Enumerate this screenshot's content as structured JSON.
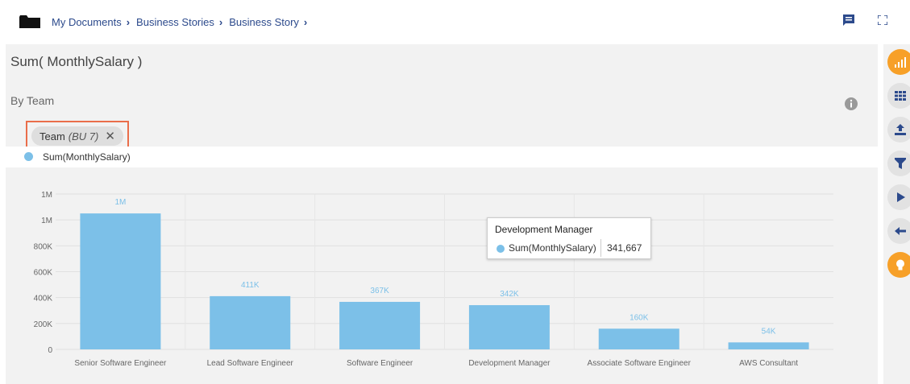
{
  "breadcrumb": {
    "items": [
      "My Documents",
      "Business Stories",
      "Business Story"
    ]
  },
  "widget": {
    "title": "Sum( MonthlySalary )",
    "subtitle": "By Team"
  },
  "filter_chip": {
    "label": "Team",
    "value": "(BU 7)",
    "close": "✕"
  },
  "legend": {
    "label": "Sum(MonthlySalary)",
    "color": "#7cc0e8"
  },
  "tooltip": {
    "title": "Development Manager",
    "series": "Sum(MonthlySalary)",
    "value": "341,667"
  },
  "colors": {
    "bar": "#7cc0e8",
    "accent": "#f7a028",
    "highlight_border": "#ea6d4a",
    "breadcrumb_text": "#2c4a8c"
  },
  "icons": {
    "top_right": [
      "comment-icon",
      "fullscreen-icon"
    ],
    "rail": [
      "bar-chart-icon",
      "grid-icon",
      "export-icon",
      "filter-icon",
      "play-icon",
      "back-arrow-icon",
      "lightbulb-icon"
    ]
  },
  "chart_data": {
    "type": "bar",
    "categories": [
      "Senior Software Engineer",
      "Lead Software Engineer",
      "Software Engineer",
      "Development Manager",
      "Associate Software Engineer",
      "AWS Consultant"
    ],
    "values": [
      1050000,
      411000,
      367000,
      341667,
      160000,
      54000
    ],
    "data_labels": [
      "1M",
      "411K",
      "367K",
      "342K",
      "160K",
      "54K"
    ],
    "y_ticks": [
      0,
      200000,
      400000,
      600000,
      800000,
      1000000,
      1200000
    ],
    "y_tick_labels": [
      "0",
      "200K",
      "400K",
      "600K",
      "800K",
      "1M",
      "1M"
    ],
    "ylim": [
      0,
      1200000
    ],
    "grid": true,
    "title": "",
    "xlabel": "",
    "ylabel": ""
  }
}
